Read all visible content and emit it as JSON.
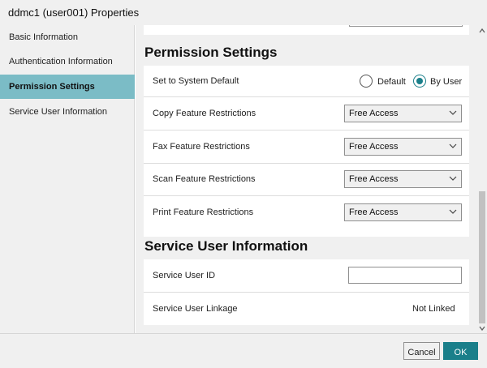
{
  "window": {
    "title": "ddmc1 (user001) Properties"
  },
  "sidebar": {
    "items": [
      {
        "label": "Basic Information",
        "active": false
      },
      {
        "label": "Authentication Information",
        "active": false
      },
      {
        "label": "Permission Settings",
        "active": true
      },
      {
        "label": "Service User Information",
        "active": false
      }
    ]
  },
  "permission": {
    "title": "Permission Settings",
    "system_default": {
      "label": "Set to System Default",
      "options": [
        "Default",
        "By User"
      ],
      "selected": "By User"
    },
    "rows": [
      {
        "label": "Copy Feature Restrictions",
        "value": "Free Access"
      },
      {
        "label": "Fax Feature Restrictions",
        "value": "Free Access"
      },
      {
        "label": "Scan Feature Restrictions",
        "value": "Free Access"
      },
      {
        "label": "Print Feature Restrictions",
        "value": "Free Access"
      }
    ]
  },
  "service_user": {
    "title": "Service User Information",
    "id_label": "Service User ID",
    "id_value": "",
    "linkage_label": "Service User Linkage",
    "linkage_value": "Not Linked"
  },
  "footer": {
    "cancel_label": "Cancel",
    "ok_label": "OK"
  },
  "colors": {
    "accent": "#1a7f8a",
    "sidebar_active": "#7bbcc6"
  }
}
